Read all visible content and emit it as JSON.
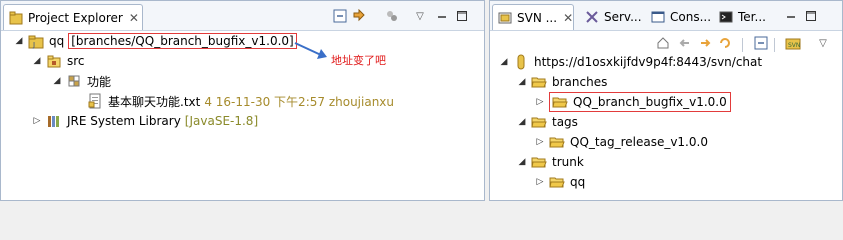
{
  "left_view": {
    "tab": {
      "title": "Project Explorer",
      "close": "✕"
    },
    "tree": {
      "project": {
        "name": "qq",
        "branch_decoration": "[branches/QQ_branch_bugfix_v1.0.0]"
      },
      "src": {
        "label": "src"
      },
      "package": {
        "label": "功能"
      },
      "file": {
        "name": "基本聊天功能.txt",
        "decoration": "4  16-11-30 下午2:57  zhoujianxu"
      },
      "jre": {
        "label": "JRE System Library",
        "decoration": "[JavaSE-1.8]"
      }
    },
    "annotation": {
      "text": "地址变了吧",
      "color": "#e01818"
    }
  },
  "right_view": {
    "tabs": [
      {
        "label": "SVN ...",
        "close": "✕"
      },
      {
        "label": "Serv..."
      },
      {
        "label": "Cons..."
      },
      {
        "label": "Ter..."
      }
    ],
    "tree": {
      "repo": {
        "url": "https://d1osxkijfdv9p4f:8443/svn/chat"
      },
      "branches": {
        "label": "branches"
      },
      "branch_item": {
        "label": "QQ_branch_bugfix_v1.0.0"
      },
      "tags": {
        "label": "tags"
      },
      "tag_item": {
        "label": "QQ_tag_release_v1.0.0"
      },
      "trunk": {
        "label": "trunk"
      },
      "trunk_item": {
        "label": "qq"
      }
    }
  },
  "colors": {
    "highlight_border": "#e23b3b",
    "decoration": "#a68b2c",
    "folder": "#e8c34a",
    "accent": "#3a6ea5"
  },
  "icons": {
    "project": "java-project-svn-icon",
    "src": "source-folder-icon",
    "package": "package-icon",
    "file": "text-file-icon",
    "jre": "library-icon",
    "repo": "svn-repository-icon",
    "folder": "folder-icon"
  }
}
